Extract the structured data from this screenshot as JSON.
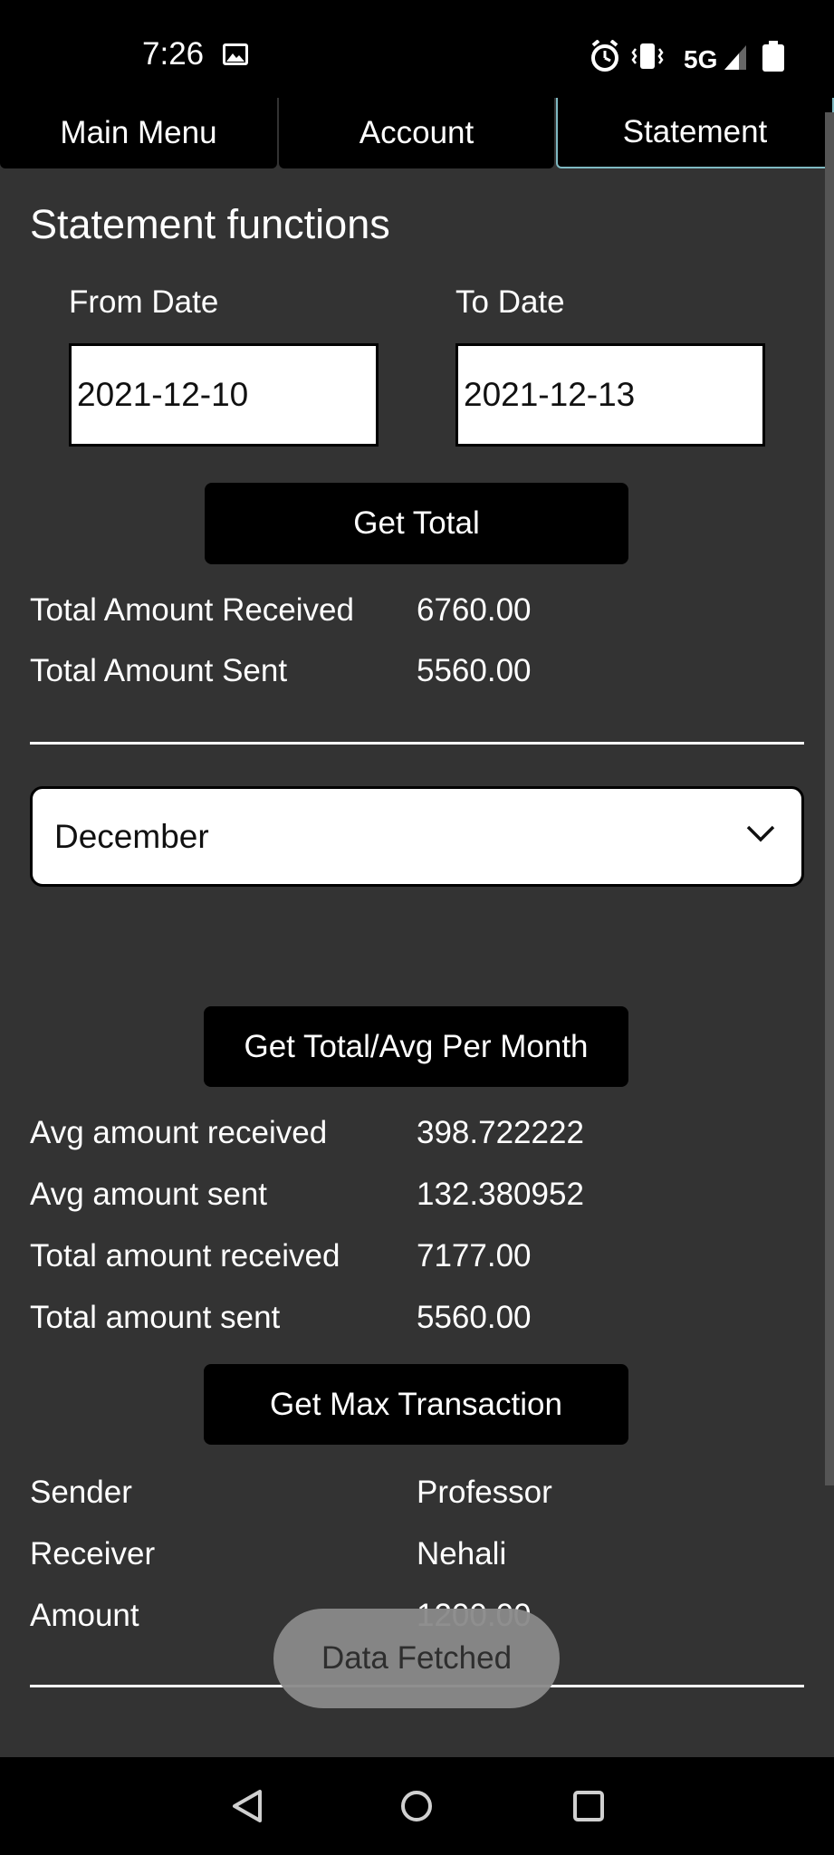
{
  "status_bar": {
    "time": "7:26",
    "network": "5G",
    "icons": [
      "image-icon",
      "alarm-icon",
      "vibrate-icon",
      "signal-icon",
      "battery-icon"
    ]
  },
  "tabs": [
    {
      "label": "Main Menu",
      "active": false
    },
    {
      "label": "Account",
      "active": false
    },
    {
      "label": "Statement",
      "active": true
    }
  ],
  "statement": {
    "heading": "Statement functions",
    "from_label": "From Date",
    "from_value": "2021-12-10",
    "to_label": "To Date",
    "to_value": "2021-12-13",
    "get_total_label": "Get Total",
    "totals": [
      {
        "label": "Total Amount Received",
        "value": "6760.00"
      },
      {
        "label": "Total Amount Sent",
        "value": "5560.00"
      }
    ]
  },
  "monthly": {
    "selected_month": "December",
    "button_label": "Get Total/Avg Per Month",
    "rows": [
      {
        "label": "Avg amount received",
        "value": "398.722222"
      },
      {
        "label": "Avg amount sent",
        "value": "132.380952"
      },
      {
        "label": "Total amount received",
        "value": "7177.00"
      },
      {
        "label": "Total amount sent",
        "value": "5560.00"
      }
    ]
  },
  "max_transaction": {
    "button_label": "Get Max Transaction",
    "rows": [
      {
        "label": "Sender",
        "value": "Professor"
      },
      {
        "label": "Receiver",
        "value": "Nehali"
      },
      {
        "label": "Amount",
        "value": "1200.00"
      }
    ]
  },
  "toast": "Data Fetched",
  "colors": {
    "background": "#333333",
    "bar": "#000000",
    "active_tab_border": "#7fb9c2",
    "toast": "#8a8a8a"
  }
}
